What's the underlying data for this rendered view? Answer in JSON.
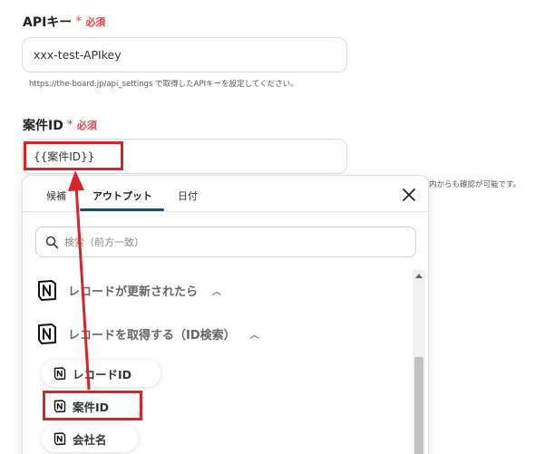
{
  "api_key": {
    "label": "APIキー",
    "required_mark": "*",
    "required_text": "必須",
    "value": "xxx-test-APIkey",
    "hint": "https://the-board.jp/api_settings で取得したAPIキーを設定してください。"
  },
  "project_id": {
    "label": "案件ID",
    "required_mark": "*",
    "required_text": "必須",
    "value": "{{案件ID}}",
    "hint_tail": "内からも確認が可能です。"
  },
  "panel": {
    "tabs": [
      {
        "label": "候補"
      },
      {
        "label": "アウトプット",
        "active": true
      },
      {
        "label": "日付"
      }
    ],
    "search_placeholder": "検索（前方一致）",
    "sections": [
      {
        "title": "レコードが更新されたら",
        "chevron": "︿"
      },
      {
        "title": "レコードを取得する（ID検索）",
        "chevron": "︿"
      }
    ],
    "items": [
      {
        "label": "レコードID"
      },
      {
        "label": "案件ID"
      },
      {
        "label": "会社名"
      }
    ]
  },
  "colors": {
    "accent": "#1f4e63",
    "required": "#e5484d",
    "highlight": "#d8232a"
  }
}
